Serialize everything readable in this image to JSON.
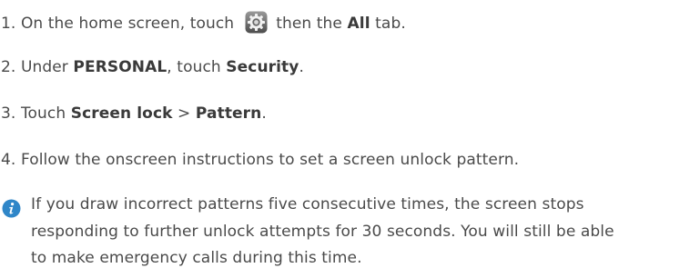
{
  "steps": [
    {
      "number": "1.",
      "text_before": "On the home screen, touch",
      "icon": "settings-gear-icon",
      "text_after": "then the",
      "bold": "All",
      "text_end": "tab."
    },
    {
      "number": "2.",
      "text_before": "Under",
      "bold1": "PERSONAL",
      "text_mid": ", touch",
      "bold2": "Security",
      "text_end": "."
    },
    {
      "number": "3.",
      "text_before": "Touch",
      "bold1": "Screen lock",
      "separator": ">",
      "bold2": "Pattern",
      "text_end": "."
    },
    {
      "number": "4.",
      "text": "Follow the onscreen instructions to set a screen unlock pattern."
    }
  ],
  "note": {
    "icon": "info-icon",
    "lines": [
      "If you draw incorrect patterns five consecutive times, the screen stops",
      "responding to further unlock attempts for 30 seconds. You will still be able",
      "to make emergency calls during this time."
    ]
  },
  "colors": {
    "text": "#4a4a4a",
    "accent": "#2f86c8"
  }
}
